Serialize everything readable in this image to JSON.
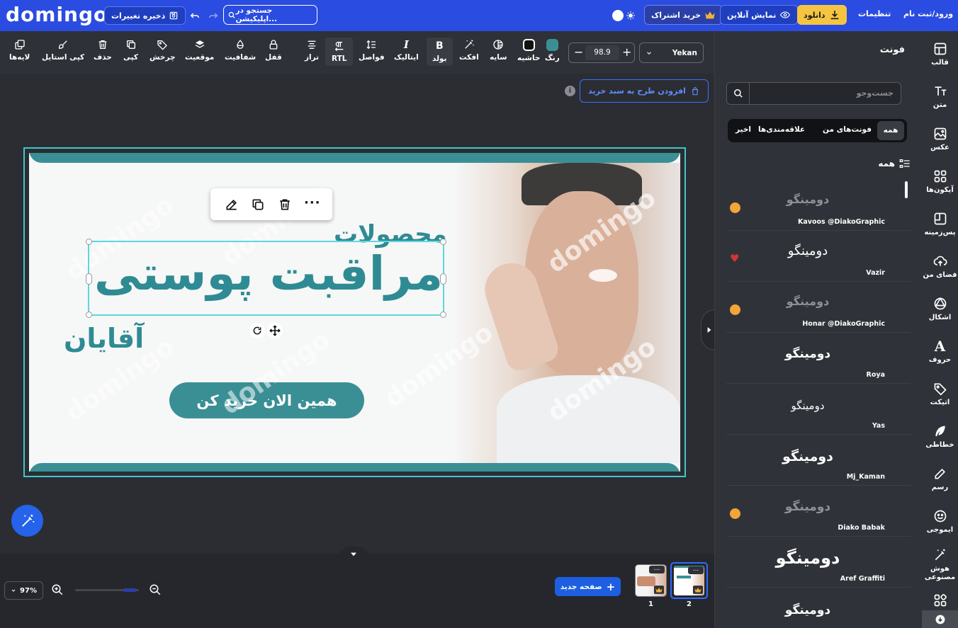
{
  "topbar": {
    "logo": "domingo",
    "save_label": "ذخیره تغییرات",
    "search_placeholder": "جستجو در اپلیکیشن...",
    "subscribe_label": "خرید اشتراک",
    "preview_label": "نمایش آنلاین",
    "download_label": "دانلود",
    "settings_label": "تنظیمات",
    "login_label": "ورود/ثبت نام"
  },
  "toolbar": {
    "font_family": "Yekan",
    "font_size": "98.9",
    "tools": [
      {
        "label": "رنگ",
        "icon": "color-swatch-icon"
      },
      {
        "label": "حاشیه",
        "icon": "border-icon"
      },
      {
        "label": "سایه",
        "icon": "shadow-icon"
      },
      {
        "label": "افکت",
        "icon": "effect-wand-icon"
      },
      {
        "label": "بولد",
        "icon": "bold-icon"
      },
      {
        "label": "ایتالیک",
        "icon": "italic-icon"
      },
      {
        "label": "فواصل",
        "icon": "spacing-icon"
      },
      {
        "label": "RTL",
        "icon": "rtl-icon"
      },
      {
        "label": "تراز",
        "icon": "align-icon"
      },
      {
        "label": "قفل",
        "icon": "lock-icon"
      },
      {
        "label": "شفافیت",
        "icon": "opacity-icon"
      },
      {
        "label": "موقعیت",
        "icon": "position-icon"
      },
      {
        "label": "چرخش",
        "icon": "rotate-icon"
      },
      {
        "label": "کپی",
        "icon": "copy-icon"
      },
      {
        "label": "حذف",
        "icon": "trash-icon"
      },
      {
        "label": "کپی استایل",
        "icon": "brush-icon"
      },
      {
        "label": "لایه‌ها",
        "icon": "layers-icon"
      }
    ],
    "color_swatch": "#3a8f95"
  },
  "canvas": {
    "add_to_cart_label": "افزودن طرح به سبد خرید",
    "design": {
      "line1": "محصولات",
      "line2": "مراقبت پوستی",
      "line3": "آقایان",
      "cta": "همین الان خرید کن",
      "watermark": "domingo",
      "accent": "#2e8b93"
    }
  },
  "bottombar": {
    "zoom": "97%",
    "new_page_label": "صفحه جدید",
    "pages": [
      "1",
      "2"
    ]
  },
  "panel": {
    "title": "فونت",
    "search_placeholder": "جست‌وجو",
    "filters": [
      "همه",
      "فونت‌های من",
      "علاقه‌مندی‌ها",
      "اخیر"
    ],
    "section_title": "همه",
    "fonts": [
      {
        "sample": "دومینگو",
        "name": "Kavoos @DiakoGraphic",
        "badge": "premium"
      },
      {
        "sample": "دومینگو",
        "name": "Vazir",
        "badge": "heart"
      },
      {
        "sample": "دومینگو",
        "name": "Honar @DiakoGraphic",
        "badge": "premium"
      },
      {
        "sample": "دومینگو",
        "name": "Roya",
        "badge": ""
      },
      {
        "sample": "دومینگو",
        "name": "Yas",
        "badge": ""
      },
      {
        "sample": "دومینگو",
        "name": "Mj_Kaman",
        "badge": ""
      },
      {
        "sample": "دومینگو",
        "name": "Diako Babak",
        "badge": "premium"
      },
      {
        "sample": "دومینگو",
        "name": "Aref Graffiti",
        "badge": ""
      },
      {
        "sample": "دومینگو",
        "name": "",
        "badge": ""
      }
    ]
  },
  "rail": [
    {
      "label": "قالب",
      "icon": "template-icon"
    },
    {
      "label": "متن",
      "icon": "text-icon"
    },
    {
      "label": "عکس",
      "icon": "image-icon"
    },
    {
      "label": "آیکون‌ها",
      "icon": "icons-grid-icon"
    },
    {
      "label": "پس‌زمینه",
      "icon": "background-icon"
    },
    {
      "label": "فضای من",
      "icon": "cloud-upload-icon"
    },
    {
      "label": "اشکال",
      "icon": "shapes-icon"
    },
    {
      "label": "حروف",
      "icon": "letters-icon"
    },
    {
      "label": "اتیکت",
      "icon": "tag-icon"
    },
    {
      "label": "خطاطی",
      "icon": "feather-icon"
    },
    {
      "label": "رسم",
      "icon": "pencil-icon"
    },
    {
      "label": "ایموجی",
      "icon": "emoji-icon"
    },
    {
      "label": "هوش مصنوعی",
      "icon": "ai-wand-icon"
    }
  ]
}
